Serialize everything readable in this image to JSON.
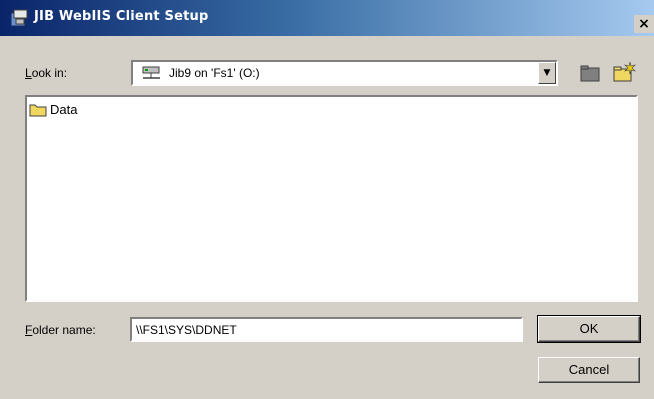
{
  "window": {
    "title": "JIB WebIIS Client Setup",
    "close_glyph": "×"
  },
  "lookin": {
    "label_underlined": "L",
    "label_rest": "ook in:",
    "value": "Jib9 on 'Fs1' (O:)",
    "drop_glyph": "▼",
    "icon": "network-drive-icon"
  },
  "toolbar": {
    "up_icon": "up-folder-icon",
    "new_icon": "new-folder-icon"
  },
  "files": [
    {
      "name": "Data",
      "icon": "folder-icon"
    }
  ],
  "folder": {
    "label_underlined": "F",
    "label_rest": "older name:",
    "value": "\\\\FS1\\SYS\\DDNET"
  },
  "buttons": {
    "ok": "OK",
    "cancel": "Cancel"
  },
  "colors": {
    "title_start": "#0a246a",
    "title_end": "#a6caf0",
    "face": "#d4d0c8"
  }
}
